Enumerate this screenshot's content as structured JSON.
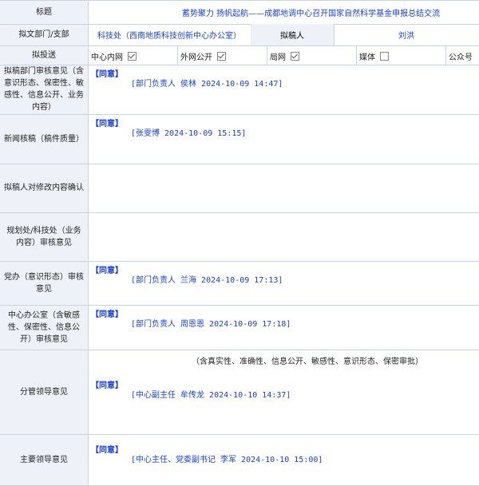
{
  "title": {
    "label": "标题",
    "value": "蓄势聚力 扬帆起航——成都地调中心召开国家自然科学基金申报总结交流"
  },
  "dept": {
    "label": "拟文部门/支部",
    "value": "科技处（西南地质科技创新中心办公室）",
    "drafter_label": "拟稿人",
    "drafter_value": "刘洪"
  },
  "media": {
    "label": "拟投送",
    "items": [
      {
        "label": "中心内网",
        "checked": true
      },
      {
        "label": "外网公开",
        "checked": true
      },
      {
        "label": "局网",
        "checked": true
      },
      {
        "label": "媒体",
        "checked": false
      },
      {
        "label": "公众号",
        "checked": false
      }
    ]
  },
  "reviews": [
    {
      "label": "拟稿部门审核意见（含意识形态、保密性、敏感性、信息公开、业务内容）",
      "agree": "【同意】",
      "sign": "[部门负责人 侯林 2024-10-09 14:47]"
    },
    {
      "label": "新闻核稿（稿件质量）",
      "agree": "【同意】",
      "sign": "[张雯博 2024-10-09 15:15]"
    },
    {
      "label": "拟稿人对修改内容确认",
      "agree": "",
      "sign": ""
    },
    {
      "label": "规划处/科技处（业务内容）审核意见",
      "agree": "",
      "sign": ""
    },
    {
      "label": "党办（意识形态）审核意见",
      "agree": "【同意】",
      "sign": "[部门负责人 兰海 2024-10-09 17:13]"
    },
    {
      "label": "中心办公室（含敏感性、保密性、信息公开）审核意见",
      "agree": "【同意】",
      "sign": "[部门负责人 周恩恩 2024-10-09 17:18]"
    },
    {
      "label": "分管领导意见",
      "note": "（含真实性、准确性、信息公开、敏感性、意识形态、保密审批）",
      "agree": "【同意】",
      "sign": "[中心副主任 牟传龙 2024-10-10 14:37]"
    },
    {
      "label": "主要领导意见",
      "agree": "【同意】",
      "sign": "[中心主任、党委副书记 李军 2024-10-10 15:00]"
    }
  ]
}
